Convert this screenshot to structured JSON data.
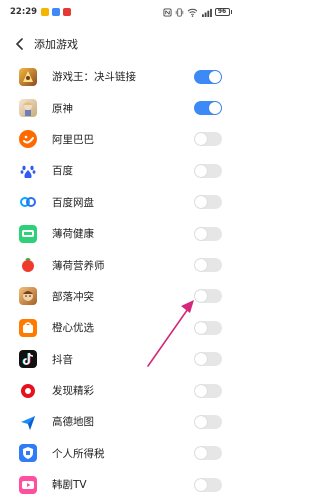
{
  "status_bar": {
    "time": "22:29",
    "battery": "96",
    "notification_colors": [
      "#f4b400",
      "#3d8af7",
      "#e53935"
    ]
  },
  "header": {
    "title": "添加游戏",
    "back_icon": "chevron-left-icon"
  },
  "colors": {
    "accent": "#3d8af7",
    "toggle_off": "#e6e6e6",
    "arrow": "#d6287a"
  },
  "apps": [
    {
      "label": "游戏王：决斗链接",
      "enabled": true
    },
    {
      "label": "原神",
      "enabled": true
    },
    {
      "label": "阿里巴巴",
      "enabled": false
    },
    {
      "label": "百度",
      "enabled": false
    },
    {
      "label": "百度网盘",
      "enabled": false
    },
    {
      "label": "薄荷健康",
      "enabled": false
    },
    {
      "label": "薄荷营养师",
      "enabled": false
    },
    {
      "label": "部落冲突",
      "enabled": false
    },
    {
      "label": "橙心优选",
      "enabled": false
    },
    {
      "label": "抖音",
      "enabled": false
    },
    {
      "label": "发现精彩",
      "enabled": false
    },
    {
      "label": "高德地图",
      "enabled": false
    },
    {
      "label": "个人所得税",
      "enabled": false
    },
    {
      "label": "韩剧TV",
      "enabled": false
    }
  ]
}
